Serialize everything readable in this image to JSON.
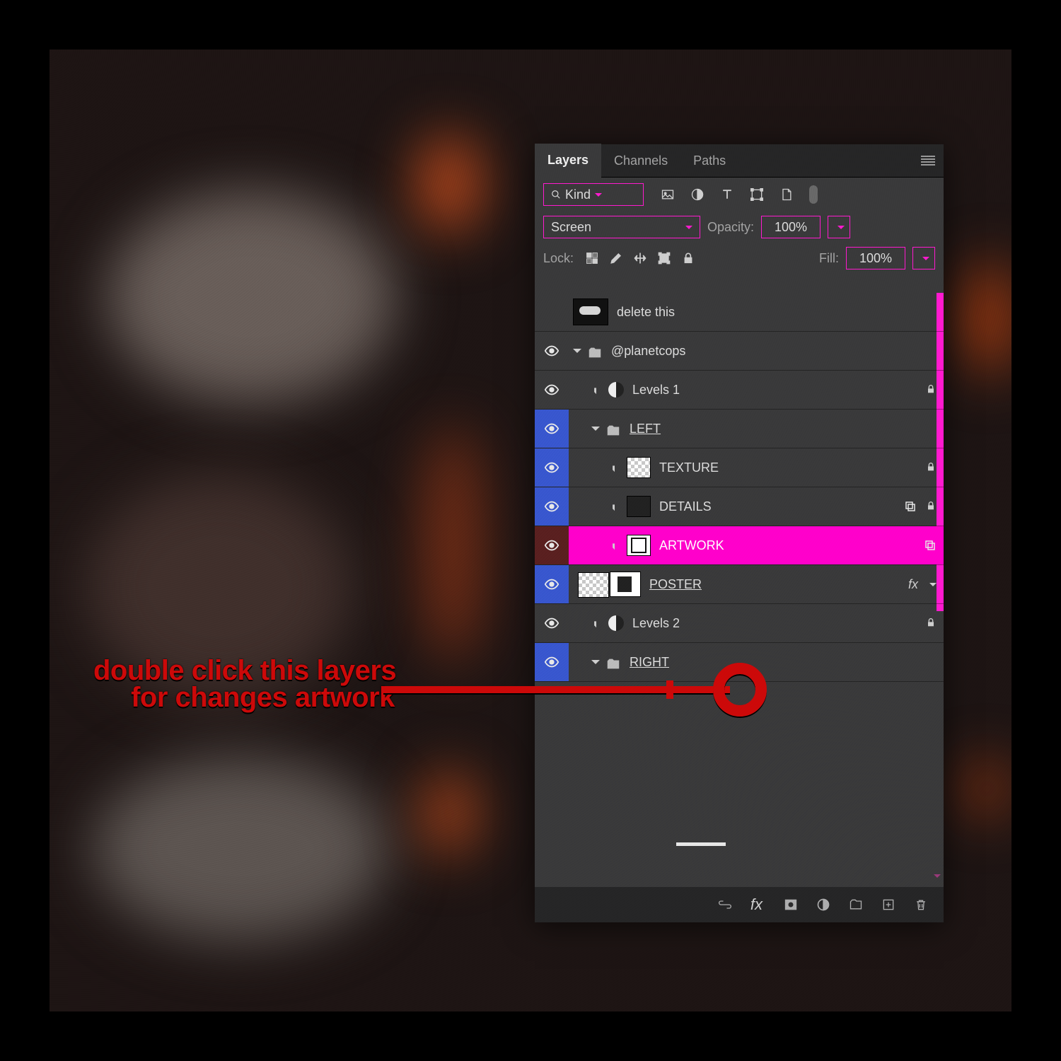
{
  "instruction": {
    "line1": "double click this layers",
    "line2": "for changes artwork"
  },
  "panel": {
    "tabs": {
      "layers": "Layers",
      "channels": "Channels",
      "paths": "Paths"
    },
    "filter": {
      "kind": "Kind"
    },
    "blend": {
      "mode": "Screen",
      "opacity_label": "Opacity:",
      "opacity_value": "100%"
    },
    "lock": {
      "label": "Lock:",
      "fill_label": "Fill:",
      "fill_value": "100%"
    }
  },
  "layers": [
    {
      "id": "delete",
      "name": "delete this",
      "visible": false,
      "eyeBg": "",
      "indent": 0,
      "type": "image",
      "thumb": "big",
      "underline": false,
      "locked": false
    },
    {
      "id": "planetcops",
      "name": "@planetcops",
      "visible": true,
      "eyeBg": "",
      "indent": 0,
      "type": "group",
      "open": true,
      "underline": false,
      "locked": false
    },
    {
      "id": "levels1",
      "name": "Levels 1",
      "visible": true,
      "eyeBg": "",
      "indent": 1,
      "type": "adjust",
      "clip": true,
      "underline": false,
      "locked": true
    },
    {
      "id": "left",
      "name": "LEFT",
      "visible": true,
      "eyeBg": "blue",
      "indent": 1,
      "type": "group",
      "open": true,
      "underline": true,
      "locked": false
    },
    {
      "id": "texture",
      "name": "TEXTURE",
      "visible": true,
      "eyeBg": "blue",
      "indent": 2,
      "type": "layer",
      "thumb": "checker",
      "clip": true,
      "underline": false,
      "locked": true
    },
    {
      "id": "details",
      "name": "DETAILS",
      "visible": true,
      "eyeBg": "blue",
      "indent": 2,
      "type": "layer",
      "thumb": "dark",
      "clip": true,
      "underline": false,
      "locked": true,
      "smart": true
    },
    {
      "id": "artwork",
      "name": "ARTWORK",
      "visible": true,
      "eyeBg": "darkred",
      "indent": 2,
      "type": "layer",
      "thumb": "smart",
      "clip": true,
      "underline": false,
      "locked": false,
      "smart": true,
      "selected": true
    },
    {
      "id": "poster",
      "name": "POSTER",
      "visible": true,
      "eyeBg": "blue",
      "indent": 2,
      "type": "layer",
      "thumb": "mask",
      "underline": true,
      "locked": false,
      "fx": true
    },
    {
      "id": "levels2",
      "name": "Levels 2",
      "visible": true,
      "eyeBg": "",
      "indent": 1,
      "type": "adjust",
      "clip": true,
      "underline": false,
      "locked": true
    },
    {
      "id": "right",
      "name": "RIGHT",
      "visible": true,
      "eyeBg": "blue",
      "indent": 1,
      "type": "group",
      "open": true,
      "underline": true,
      "locked": false
    }
  ],
  "fx_label": "fx"
}
